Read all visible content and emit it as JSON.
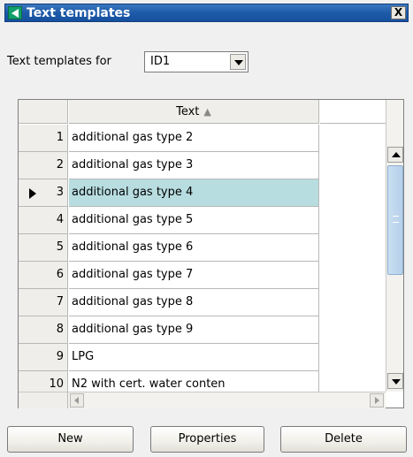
{
  "window": {
    "title": "Text templates",
    "close_label": "X"
  },
  "filter": {
    "label": "Text templates for",
    "selected": "ID1"
  },
  "grid": {
    "column_header": "Text",
    "sort_indicator": "▲",
    "selected_row": 3,
    "rows": [
      {
        "num": "1",
        "text": "additional gas type 2"
      },
      {
        "num": "2",
        "text": "additional gas type 3"
      },
      {
        "num": "3",
        "text": "additional gas type 4"
      },
      {
        "num": "4",
        "text": "additional gas type 5"
      },
      {
        "num": "5",
        "text": "additional gas type 6"
      },
      {
        "num": "6",
        "text": "additional gas type 7"
      },
      {
        "num": "7",
        "text": "additional gas type 8"
      },
      {
        "num": "8",
        "text": "additional gas type 9"
      },
      {
        "num": "9",
        "text": "LPG"
      },
      {
        "num": "10",
        "text": "N2 with cert. water conten"
      }
    ]
  },
  "buttons": {
    "new": "New",
    "properties": "Properties",
    "delete": "Delete"
  },
  "colors": {
    "selection": "#b8dde0",
    "titlebar": "#1e5aa8"
  },
  "icons": [
    "app-icon",
    "close-icon",
    "dropdown-arrow-icon",
    "sort-ascending-icon",
    "row-pointer-icon",
    "scroll-up-icon",
    "scroll-down-icon",
    "scroll-left-icon",
    "scroll-right-icon"
  ]
}
